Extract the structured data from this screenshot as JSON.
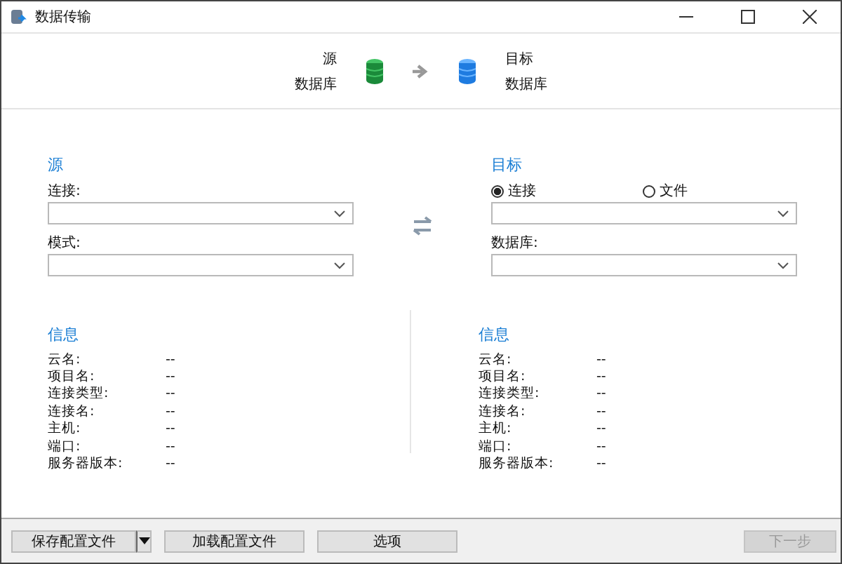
{
  "window": {
    "title": "数据传输"
  },
  "header": {
    "source_lines": [
      "源",
      "数据库"
    ],
    "target_lines": [
      "目标",
      "数据库"
    ]
  },
  "source": {
    "title": "源",
    "fields": [
      {
        "label": "连接:"
      },
      {
        "label": "模式:"
      }
    ]
  },
  "target": {
    "title": "目标",
    "options": [
      {
        "label": "连接",
        "selected": true
      },
      {
        "label": "文件",
        "selected": false
      }
    ],
    "fields": [
      {
        "label": "数据库:"
      }
    ]
  },
  "source_info": {
    "title": "信息",
    "rows": [
      {
        "label": "云名:",
        "value": "--"
      },
      {
        "label": "项目名:",
        "value": "--"
      },
      {
        "label": "连接类型:",
        "value": "--"
      },
      {
        "label": "连接名:",
        "value": "--"
      },
      {
        "label": "主机:",
        "value": "--"
      },
      {
        "label": "端口:",
        "value": "--"
      },
      {
        "label": "服务器版本:",
        "value": "--"
      }
    ]
  },
  "target_info": {
    "title": "信息",
    "rows": [
      {
        "label": "云名:",
        "value": "--"
      },
      {
        "label": "项目名:",
        "value": "--"
      },
      {
        "label": "连接类型:",
        "value": "--"
      },
      {
        "label": "连接名:",
        "value": "--"
      },
      {
        "label": "主机:",
        "value": "--"
      },
      {
        "label": "端口:",
        "value": "--"
      },
      {
        "label": "服务器版本:",
        "value": "--"
      }
    ]
  },
  "footer_buttons": [
    {
      "label": "保存配置文件",
      "kind": "split",
      "disabled": false
    },
    {
      "label": "加载配置文件",
      "kind": "plain",
      "disabled": false
    },
    {
      "label": "选项",
      "kind": "plain",
      "disabled": false
    },
    {
      "label": "下一步",
      "kind": "plain",
      "disabled": true
    }
  ]
}
